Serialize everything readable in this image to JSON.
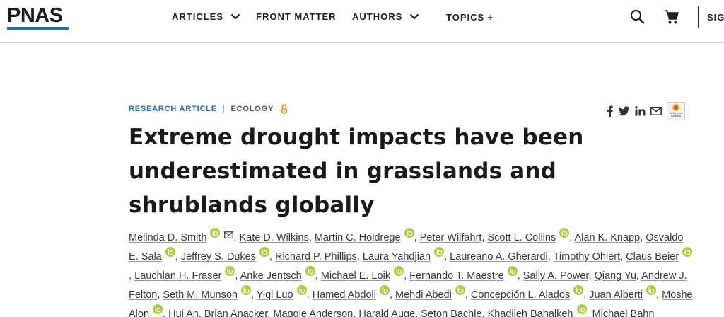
{
  "header": {
    "logo": "PNAS",
    "nav": [
      {
        "label": "ARTICLES",
        "dropdown": true
      },
      {
        "label": "FRONT MATTER",
        "dropdown": false
      },
      {
        "label": "AUTHORS",
        "dropdown": true
      },
      {
        "label": "TOPICS",
        "plus": "+"
      }
    ],
    "signin_label": "SIGN"
  },
  "article": {
    "type": "RESEARCH ARTICLE",
    "separator": "|",
    "subject": "ECOLOGY",
    "title": "Extreme drought impacts have been underestimated in grasslands and shrublands globally",
    "check_for_updates": "Check for updates",
    "authors": [
      {
        "name": "Melinda D. Smith",
        "orcid": true,
        "email": true
      },
      {
        "name": "Kate D. Wilkins",
        "orcid": false
      },
      {
        "name": "Martin C. Holdrege",
        "orcid": true
      },
      {
        "name": "Peter Wilfahrt",
        "orcid": false
      },
      {
        "name": "Scott L. Collins",
        "orcid": true
      },
      {
        "name": "Alan K. Knapp",
        "orcid": false
      },
      {
        "name": "Osvaldo E. Sala",
        "orcid": true
      },
      {
        "name": "Jeffrey S. Dukes",
        "orcid": true
      },
      {
        "name": "Richard P. Phillips",
        "orcid": false
      },
      {
        "name": "Laura Yahdjian",
        "orcid": true
      },
      {
        "name": "Laureano A. Gherardi",
        "orcid": false
      },
      {
        "name": "Timothy Ohlert",
        "orcid": false
      },
      {
        "name": "Claus Beier",
        "orcid": true
      },
      {
        "name": "Lauchlan H. Fraser",
        "orcid": true
      },
      {
        "name": "Anke Jentsch",
        "orcid": true
      },
      {
        "name": "Michael E. Loik",
        "orcid": true
      },
      {
        "name": "Fernando T. Maestre",
        "orcid": true
      },
      {
        "name": "Sally A. Power",
        "orcid": false
      },
      {
        "name": "Qiang Yu",
        "orcid": false
      },
      {
        "name": "Andrew J. Felton",
        "orcid": false
      },
      {
        "name": "Seth M. Munson",
        "orcid": true
      },
      {
        "name": "Yiqi Luo",
        "orcid": true
      },
      {
        "name": "Hamed Abdoli",
        "orcid": true
      },
      {
        "name": "Mehdi Abedi",
        "orcid": true
      },
      {
        "name": "Concepción L. Alados",
        "orcid": true
      },
      {
        "name": "Juan Alberti",
        "orcid": true
      },
      {
        "name": "Moshe Alon",
        "orcid": true
      },
      {
        "name": "Hui An",
        "orcid": false
      },
      {
        "name": "Brian Anacker",
        "orcid": false
      },
      {
        "name": "Maggie Anderson",
        "orcid": false
      },
      {
        "name": "Harald Auge",
        "orcid": false
      },
      {
        "name": "Seton Bachle",
        "orcid": false
      },
      {
        "name": "Khadijeh Bahalkeh",
        "orcid": true
      },
      {
        "name": "Michael Bahn",
        "orcid": false
      }
    ]
  },
  "colors": {
    "brand_blue": "#1f6fb2",
    "orcid_green": "#a6ce39",
    "open_access_orange": "#f68212"
  },
  "icons": {
    "search": "search-icon",
    "cart": "cart-icon",
    "facebook": "facebook-icon",
    "twitter": "twitter-icon",
    "linkedin": "linkedin-icon",
    "email": "email-icon",
    "open_access": "open-access-icon"
  }
}
